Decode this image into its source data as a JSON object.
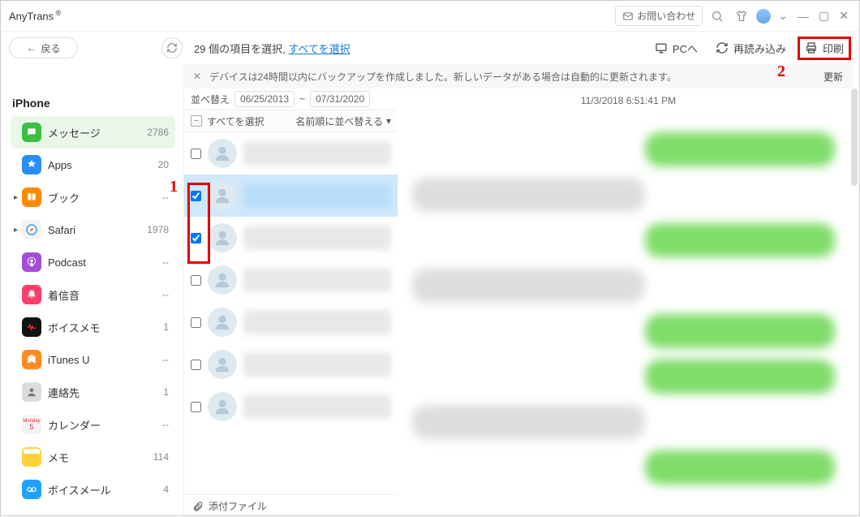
{
  "titlebar": {
    "app": "AnyTrans",
    "contact": "お問い合わせ"
  },
  "toolbar": {
    "back": "戻る",
    "selection_prefix": "29 個の項目を選択, ",
    "select_all_link": "すべてを選択",
    "to_pc": "PCへ",
    "reload": "再読み込み",
    "print": "印刷"
  },
  "notice": {
    "msg": "デバイスは24時間以内にバックアップを作成しました。新しいデータがある場合は自動的に更新されます。",
    "update": "更新"
  },
  "sidebar": {
    "title": "iPhone",
    "items": [
      {
        "label": "メッセージ",
        "count": "2786",
        "ico": "msg",
        "active": true
      },
      {
        "label": "Apps",
        "count": "20",
        "ico": "apps"
      },
      {
        "label": "ブック",
        "count": "--",
        "ico": "book",
        "caret": true
      },
      {
        "label": "Safari",
        "count": "1978",
        "ico": "safari",
        "caret": true
      },
      {
        "label": "Podcast",
        "count": "--",
        "ico": "pod"
      },
      {
        "label": "着信音",
        "count": "--",
        "ico": "ring"
      },
      {
        "label": "ボイスメモ",
        "count": "1",
        "ico": "voice"
      },
      {
        "label": "iTunes U",
        "count": "--",
        "ico": "itu"
      },
      {
        "label": "連絡先",
        "count": "1",
        "ico": "contacts"
      },
      {
        "label": "カレンダー",
        "count": "--",
        "ico": "cal"
      },
      {
        "label": "メモ",
        "count": "114",
        "ico": "memo"
      },
      {
        "label": "ボイスメール",
        "count": "4",
        "ico": "vm"
      }
    ]
  },
  "center": {
    "sort_label": "並べ替え",
    "date_from": "06/25/2013",
    "date_to": "07/31/2020",
    "tilde": "~",
    "select_all": "すべてを選択",
    "sort_by": "名前順に並べ替える",
    "attachments": "添付ファイル",
    "conversations": [
      {
        "checked": false,
        "selected": false
      },
      {
        "checked": true,
        "selected": true
      },
      {
        "checked": true,
        "selected": false
      },
      {
        "checked": false,
        "selected": false
      },
      {
        "checked": false,
        "selected": false
      },
      {
        "checked": false,
        "selected": false
      },
      {
        "checked": false,
        "selected": false
      }
    ]
  },
  "msgpane": {
    "timestamp": "11/3/2018 6:51:41 PM",
    "bubbles": [
      "green",
      "gray",
      "green",
      "gray",
      "green",
      "green",
      "gray",
      "green"
    ]
  },
  "annotations": {
    "one": "1",
    "two": "2"
  }
}
